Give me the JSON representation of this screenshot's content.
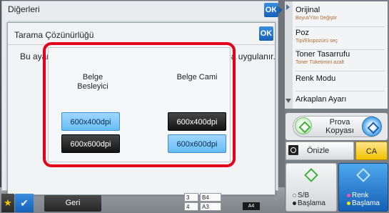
{
  "outer_dialog": {
    "title": "Diğerleri",
    "ok_label": "OK"
  },
  "inner_dialog": {
    "title": "Tarama Çözünürlüğü",
    "ok_label": "OK",
    "description": "Bu ayar, kopya oranı %100'e ayarlı olarak S/B kopyasına uygulanır.",
    "columns": [
      {
        "heading": "Belge Besleyici",
        "options": [
          {
            "label": "600x400dpi",
            "selected": true
          },
          {
            "label": "600x600dpi",
            "selected": false
          }
        ]
      },
      {
        "heading": "Belge Cami",
        "options": [
          {
            "label": "600x400dpi",
            "selected": false
          },
          {
            "label": "600x600dpi",
            "selected": true
          }
        ]
      }
    ]
  },
  "bottom_bar": {
    "back_label": "Geri"
  },
  "tray": {
    "rows": [
      {
        "num": "3",
        "size": "B4"
      },
      {
        "num": "4",
        "size": "A3"
      }
    ],
    "selected": "A4"
  },
  "sidebar": {
    "menu": [
      {
        "label": "Orijinal",
        "sub": "Boyut/Yön Değiştir"
      },
      {
        "label": "Poz",
        "sub": "Tipi/Ekspozürü seç"
      },
      {
        "label": "Toner Tasarrufu",
        "sub": "Toner Tüketimini azalt"
      },
      {
        "label": "Renk Modu",
        "sub": ""
      },
      {
        "label": "Arkaplan Ayarı",
        "sub": ""
      }
    ],
    "proof_copy_label": "Prova Kopyası",
    "preview_label": "Önizle",
    "ca_label": "CA",
    "bw_start_line1": "S/B",
    "bw_start_line2": "Başlama",
    "color_start_line1": "Renk",
    "color_start_line2": "Başlama"
  },
  "colors": {
    "accent_blue": "#1561b8",
    "highlight_red": "#e3001b",
    "selected_option": "#66bdf6",
    "ca_yellow": "#f2c300"
  }
}
